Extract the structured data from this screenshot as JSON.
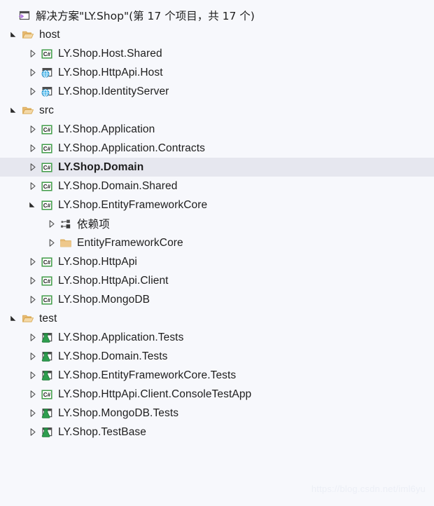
{
  "window": {
    "background_color": "#f7f8fc",
    "selection_color": "#e6e7ef"
  },
  "solution": {
    "title": "解决方案\"LY.Shop\"(第 17 个项目，共 17 个)",
    "icon": "solution-icon",
    "project_count": 17,
    "total_count": 17,
    "name": "LY.Shop"
  },
  "tree": [
    {
      "label": "host",
      "icon": "folder-open-icon",
      "level": 1,
      "expander": "expanded",
      "selected": false,
      "bold": false,
      "cjk": false
    },
    {
      "label": "LY.Shop.Host.Shared",
      "icon": "csharp-project-icon",
      "level": 2,
      "expander": "collapsed",
      "selected": false,
      "bold": false,
      "cjk": false
    },
    {
      "label": "LY.Shop.HttpApi.Host",
      "icon": "web-project-icon",
      "level": 2,
      "expander": "collapsed",
      "selected": false,
      "bold": false,
      "cjk": false
    },
    {
      "label": "LY.Shop.IdentityServer",
      "icon": "web-project-icon",
      "level": 2,
      "expander": "collapsed",
      "selected": false,
      "bold": false,
      "cjk": false
    },
    {
      "label": "src",
      "icon": "folder-open-icon",
      "level": 1,
      "expander": "expanded",
      "selected": false,
      "bold": false,
      "cjk": false
    },
    {
      "label": "LY.Shop.Application",
      "icon": "csharp-project-icon",
      "level": 2,
      "expander": "collapsed",
      "selected": false,
      "bold": false,
      "cjk": false
    },
    {
      "label": "LY.Shop.Application.Contracts",
      "icon": "csharp-project-icon",
      "level": 2,
      "expander": "collapsed",
      "selected": false,
      "bold": false,
      "cjk": false
    },
    {
      "label": "LY.Shop.Domain",
      "icon": "csharp-project-icon",
      "level": 2,
      "expander": "collapsed",
      "selected": true,
      "bold": true,
      "cjk": false
    },
    {
      "label": "LY.Shop.Domain.Shared",
      "icon": "csharp-project-icon",
      "level": 2,
      "expander": "collapsed",
      "selected": false,
      "bold": false,
      "cjk": false
    },
    {
      "label": "LY.Shop.EntityFrameworkCore",
      "icon": "csharp-project-icon",
      "level": 2,
      "expander": "expanded",
      "selected": false,
      "bold": false,
      "cjk": false
    },
    {
      "label": "依赖项",
      "icon": "dependencies-icon",
      "level": 3,
      "expander": "collapsed",
      "selected": false,
      "bold": false,
      "cjk": true
    },
    {
      "label": "EntityFrameworkCore",
      "icon": "folder-closed-icon",
      "level": 3,
      "expander": "collapsed",
      "selected": false,
      "bold": false,
      "cjk": false
    },
    {
      "label": "LY.Shop.HttpApi",
      "icon": "csharp-project-icon",
      "level": 2,
      "expander": "collapsed",
      "selected": false,
      "bold": false,
      "cjk": false
    },
    {
      "label": "LY.Shop.HttpApi.Client",
      "icon": "csharp-project-icon",
      "level": 2,
      "expander": "collapsed",
      "selected": false,
      "bold": false,
      "cjk": false
    },
    {
      "label": "LY.Shop.MongoDB",
      "icon": "csharp-project-icon",
      "level": 2,
      "expander": "collapsed",
      "selected": false,
      "bold": false,
      "cjk": false
    },
    {
      "label": "test",
      "icon": "folder-open-icon",
      "level": 1,
      "expander": "expanded",
      "selected": false,
      "bold": false,
      "cjk": false
    },
    {
      "label": "LY.Shop.Application.Tests",
      "icon": "test-project-icon",
      "level": 2,
      "expander": "collapsed",
      "selected": false,
      "bold": false,
      "cjk": false
    },
    {
      "label": "LY.Shop.Domain.Tests",
      "icon": "test-project-icon",
      "level": 2,
      "expander": "collapsed",
      "selected": false,
      "bold": false,
      "cjk": false
    },
    {
      "label": "LY.Shop.EntityFrameworkCore.Tests",
      "icon": "test-project-icon",
      "level": 2,
      "expander": "collapsed",
      "selected": false,
      "bold": false,
      "cjk": false
    },
    {
      "label": "LY.Shop.HttpApi.Client.ConsoleTestApp",
      "icon": "csharp-project-icon",
      "level": 2,
      "expander": "collapsed",
      "selected": false,
      "bold": false,
      "cjk": false
    },
    {
      "label": "LY.Shop.MongoDB.Tests",
      "icon": "test-project-icon",
      "level": 2,
      "expander": "collapsed",
      "selected": false,
      "bold": false,
      "cjk": false
    },
    {
      "label": "LY.Shop.TestBase",
      "icon": "test-project-icon",
      "level": 2,
      "expander": "collapsed",
      "selected": false,
      "bold": false,
      "cjk": false
    }
  ],
  "watermark": {
    "text": "https://blog.csdn.net/iml6yu"
  }
}
